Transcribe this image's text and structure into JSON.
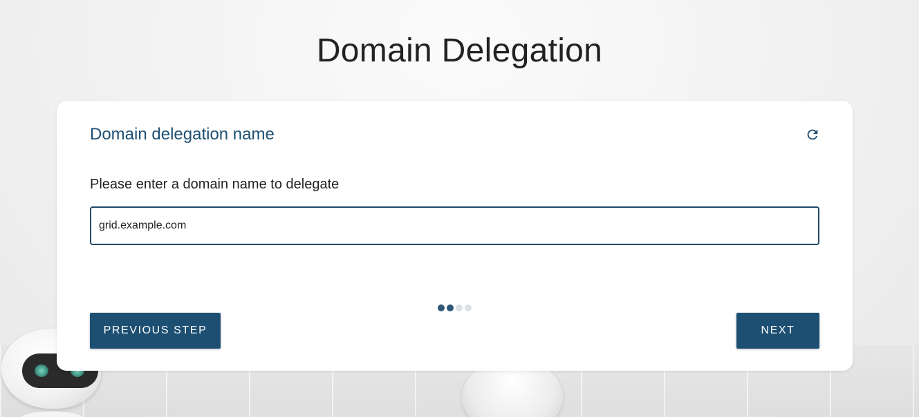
{
  "page": {
    "title": "Domain Delegation"
  },
  "card": {
    "title": "Domain delegation name",
    "refresh_icon": "refresh-icon",
    "prompt": "Please enter a domain name to delegate",
    "input_value": "grid.example.com",
    "input_placeholder": ""
  },
  "stepper": {
    "total_steps": 4,
    "current_step": 2,
    "active_color": "#2f5878",
    "inactive_color": "#dcdfe3"
  },
  "buttons": {
    "previous_label": "PREVIOUS STEP",
    "next_label": "NEXT"
  },
  "colors": {
    "primary": "#1d4f72",
    "card_title": "#1d4f72",
    "input_border": "#1f4a66"
  }
}
